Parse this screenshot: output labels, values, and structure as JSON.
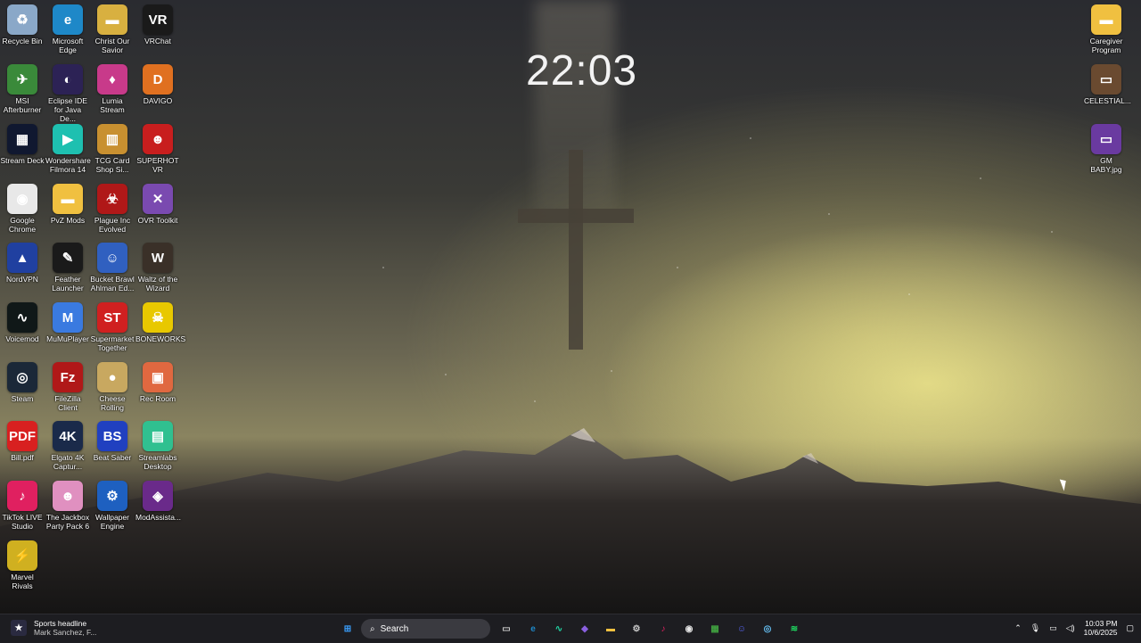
{
  "clock": "22:03",
  "desktop_icons": [
    {
      "label": "Recycle Bin",
      "icon": "recycle-bin-icon",
      "color": "#8aa8c8",
      "glyph": "♻"
    },
    {
      "label": "Microsoft Edge",
      "icon": "edge-icon",
      "color": "#1e88c8",
      "glyph": "e"
    },
    {
      "label": "Christ Our Savior",
      "icon": "folder-image-icon",
      "color": "#d8b040",
      "glyph": "▬"
    },
    {
      "label": "VRChat",
      "icon": "vrchat-icon",
      "color": "#1a1a1a",
      "glyph": "VR"
    },
    {
      "label": "MSI Afterburner",
      "icon": "msi-afterburner-icon",
      "color": "#3a8a3a",
      "glyph": "✈"
    },
    {
      "label": "Eclipse IDE for Java De...",
      "icon": "eclipse-icon",
      "color": "#2c2255",
      "glyph": "◐"
    },
    {
      "label": "Lumia Stream",
      "icon": "lumia-icon",
      "color": "#c83a8a",
      "glyph": "♦"
    },
    {
      "label": "DAVIGO",
      "icon": "davigo-icon",
      "color": "#e07020",
      "glyph": "D"
    },
    {
      "label": "Stream Deck",
      "icon": "stream-deck-icon",
      "color": "#101830",
      "glyph": "▦"
    },
    {
      "label": "Wondershare Filmora 14",
      "icon": "filmora-icon",
      "color": "#1ec0b0",
      "glyph": "▶"
    },
    {
      "label": "TCG Card Shop Si...",
      "icon": "tcg-card-icon",
      "color": "#c89030",
      "glyph": "▥"
    },
    {
      "label": "SUPERHOT VR",
      "icon": "superhot-icon",
      "color": "#c81e1e",
      "glyph": "☻"
    },
    {
      "label": "Google Chrome",
      "icon": "chrome-icon",
      "color": "#e8e8e8",
      "glyph": "◉"
    },
    {
      "label": "PvZ Mods",
      "icon": "folder-icon",
      "color": "#f0c040",
      "glyph": "▬"
    },
    {
      "label": "Plague Inc Evolved",
      "icon": "plague-icon",
      "color": "#b01818",
      "glyph": "☣"
    },
    {
      "label": "OVR Toolkit",
      "icon": "ovr-toolkit-icon",
      "color": "#7a4ab0",
      "glyph": "✕"
    },
    {
      "label": "NordVPN",
      "icon": "nordvpn-icon",
      "color": "#2040a0",
      "glyph": "▲"
    },
    {
      "label": "Feather Launcher",
      "icon": "feather-icon",
      "color": "#1a1a1a",
      "glyph": "✎"
    },
    {
      "label": "Bucket Brawl Ahlman Ed...",
      "icon": "bucket-brawl-icon",
      "color": "#3060c0",
      "glyph": "☺"
    },
    {
      "label": "Waltz of the Wizard",
      "icon": "waltz-wizard-icon",
      "color": "#3a3028",
      "glyph": "W"
    },
    {
      "label": "Voicemod",
      "icon": "voicemod-icon",
      "color": "#101818",
      "glyph": "∿"
    },
    {
      "label": "MuMuPlayer",
      "icon": "mumuplayer-icon",
      "color": "#3a7ae0",
      "glyph": "M"
    },
    {
      "label": "Supermarket Together",
      "icon": "supermarket-icon",
      "color": "#d02020",
      "glyph": "ST"
    },
    {
      "label": "BONEWORKS",
      "icon": "boneworks-icon",
      "color": "#e8c800",
      "glyph": "☠"
    },
    {
      "label": "Steam",
      "icon": "steam-icon",
      "color": "#1b2838",
      "glyph": "◎"
    },
    {
      "label": "FileZilla Client",
      "icon": "filezilla-icon",
      "color": "#b01818",
      "glyph": "Fz"
    },
    {
      "label": "Cheese Rolling",
      "icon": "cheese-icon",
      "color": "#c8a860",
      "glyph": "●"
    },
    {
      "label": "Rec Room",
      "icon": "rec-room-icon",
      "color": "#e06840",
      "glyph": "▣"
    },
    {
      "label": "Bill.pdf",
      "icon": "pdf-icon",
      "color": "#d82020",
      "glyph": "PDF"
    },
    {
      "label": "Elgato 4K Captur...",
      "icon": "elgato-icon",
      "color": "#1a2a4a",
      "glyph": "4K"
    },
    {
      "label": "Beat Saber",
      "icon": "beat-saber-icon",
      "color": "#2040c0",
      "glyph": "BS"
    },
    {
      "label": "Streamlabs Desktop",
      "icon": "streamlabs-icon",
      "color": "#30c090",
      "glyph": "▤"
    },
    {
      "label": "TikTok LIVE Studio",
      "icon": "tiktok-icon",
      "color": "#e02060",
      "glyph": "♪"
    },
    {
      "label": "The Jackbox Party Pack 6",
      "icon": "jackbox-icon",
      "color": "#e090c0",
      "glyph": "☻"
    },
    {
      "label": "Wallpaper Engine",
      "icon": "wallpaper-engine-icon",
      "color": "#1e60c0",
      "glyph": "⚙"
    },
    {
      "label": "ModAssista...",
      "icon": "modassistant-icon",
      "color": "#6a2a8a",
      "glyph": "◈"
    },
    {
      "label": "Marvel Rivals",
      "icon": "marvel-rivals-icon",
      "color": "#d0b020",
      "glyph": "⚡"
    }
  ],
  "right_icons": [
    {
      "label": "Caregiver Program",
      "icon": "folder-icon",
      "color": "#f0c040",
      "glyph": "▬"
    },
    {
      "label": "CELESTIAL...",
      "icon": "image-file-icon",
      "color": "#6a4a30",
      "glyph": "▭"
    },
    {
      "label": "GM BABY.jpg",
      "icon": "image-file-icon",
      "color": "#6a3aa0",
      "glyph": "▭"
    }
  ],
  "taskbar": {
    "news_title": "Sports headline",
    "news_sub": "Mark Sanchez, F...",
    "search_label": "Search",
    "time": "10:03 PM",
    "date": "10/6/2025",
    "apps": [
      {
        "name": "start-button",
        "glyph": "⊞",
        "color": "#3aa0ff"
      },
      {
        "name": "task-view-icon",
        "glyph": "▭",
        "color": "#cccccc"
      },
      {
        "name": "edge-taskbar-icon",
        "glyph": "e",
        "color": "#1e88c8"
      },
      {
        "name": "voicemod-taskbar-icon",
        "glyph": "∿",
        "color": "#20d0a0"
      },
      {
        "name": "copilot-icon",
        "glyph": "◆",
        "color": "#8a60e0"
      },
      {
        "name": "file-explorer-icon",
        "glyph": "▬",
        "color": "#f0c040"
      },
      {
        "name": "settings-taskbar-icon",
        "glyph": "⚙",
        "color": "#cccccc"
      },
      {
        "name": "tiktok-taskbar-icon",
        "glyph": "♪",
        "color": "#e02060"
      },
      {
        "name": "chrome-taskbar-icon",
        "glyph": "◉",
        "color": "#e8e8e8"
      },
      {
        "name": "minecraft-icon",
        "glyph": "▦",
        "color": "#40a040"
      },
      {
        "name": "discord-icon",
        "glyph": "☺",
        "color": "#5865f2"
      },
      {
        "name": "steam-taskbar-icon",
        "glyph": "◎",
        "color": "#66c0f4"
      },
      {
        "name": "spotify-icon",
        "glyph": "≋",
        "color": "#1ed760"
      }
    ]
  }
}
